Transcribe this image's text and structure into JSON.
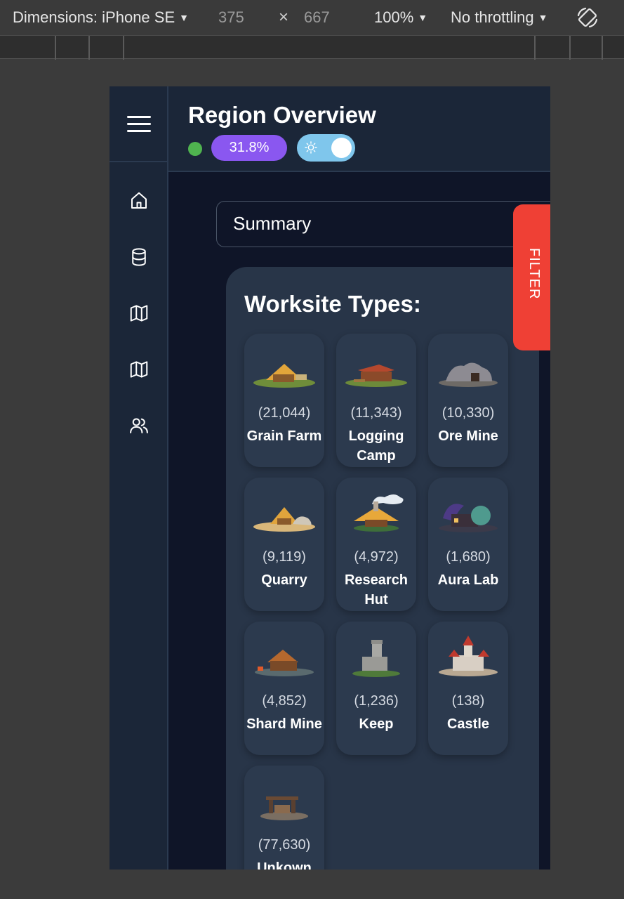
{
  "devtools": {
    "dimensions": "Dimensions: iPhone SE",
    "width": "375",
    "times": "×",
    "height": "667",
    "zoom": "100%",
    "throttling": "No throttling"
  },
  "header": {
    "title": "Region Overview",
    "percent": "31.8%"
  },
  "select": {
    "value": "Summary"
  },
  "filter_label": "FILTER",
  "card": {
    "title": "Worksite Types:",
    "items": [
      {
        "count": "(21,044)",
        "name": "Grain Farm"
      },
      {
        "count": "(11,343)",
        "name": "Logging Camp"
      },
      {
        "count": "(10,330)",
        "name": "Ore Mine"
      },
      {
        "count": "(9,119)",
        "name": "Quarry"
      },
      {
        "count": "(4,972)",
        "name": "Research Hut"
      },
      {
        "count": "(1,680)",
        "name": "Aura Lab"
      },
      {
        "count": "(4,852)",
        "name": "Shard Mine"
      },
      {
        "count": "(1,236)",
        "name": "Keep"
      },
      {
        "count": "(138)",
        "name": "Castle"
      },
      {
        "count": "(77,630)",
        "name": "Unkown"
      }
    ]
  },
  "colors": {
    "accent_purple": "#8a57f0",
    "filter_red": "#ef4035",
    "status_green": "#4fb34f",
    "toggle_blue": "#7fc6ec"
  },
  "icons": [
    "hamburger-icon",
    "home-icon",
    "database-icon",
    "map-icon",
    "users-icon",
    "sun-icon",
    "rotate-icon"
  ]
}
